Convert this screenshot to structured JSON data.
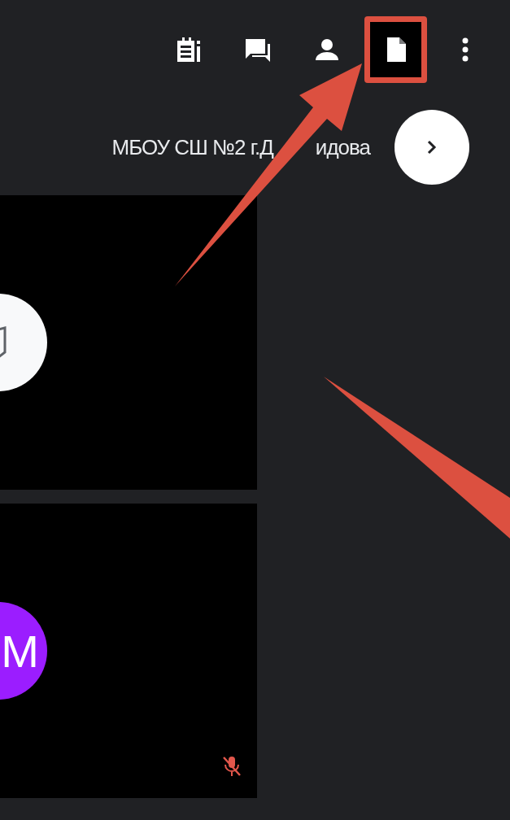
{
  "toolbar": [
    {
      "kind": "activities",
      "highlighted": false
    },
    {
      "kind": "chat",
      "highlighted": false
    },
    {
      "kind": "people",
      "highlighted": false
    },
    {
      "kind": "document",
      "highlighted": true
    },
    {
      "kind": "more",
      "highlighted": false
    }
  ],
  "meeting_title": {
    "before_arrow": "МБОУ СШ №2 г.Д",
    "after_arrow": "идова"
  },
  "tiles": [
    {
      "kind": "icon",
      "color": "#f8f9fa",
      "muted": false
    },
    {
      "kind": "initial",
      "initial": "М",
      "color": "#9b1dff",
      "muted": true
    }
  ]
}
